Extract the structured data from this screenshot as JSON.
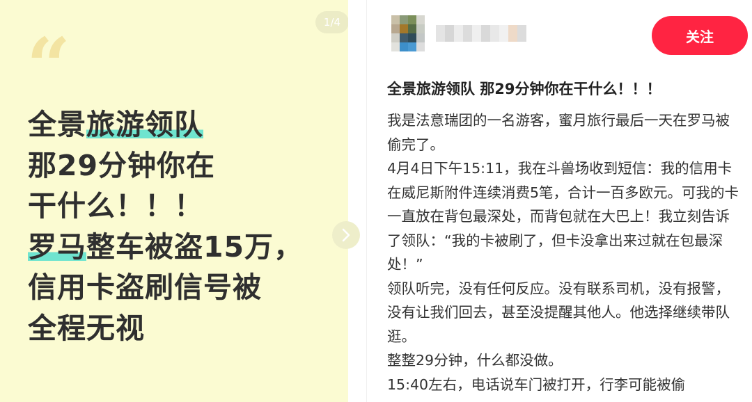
{
  "image_panel": {
    "counter": "1/4",
    "quote_glyph": "“",
    "headline_lines": [
      {
        "before": "全景",
        "highlight": "旅游领队",
        "after": ""
      },
      {
        "before": "那29分钟你在",
        "highlight": "",
        "after": ""
      },
      {
        "before": "干什么！！！",
        "highlight": "",
        "after": ""
      },
      {
        "before": "",
        "highlight": "罗马",
        "after": "整车被盗15万，"
      },
      {
        "before": "信用卡盗刷信号被",
        "highlight": "",
        "after": ""
      },
      {
        "before": "全程无视",
        "highlight": "",
        "after": ""
      }
    ],
    "highlight_color": "#6fe4cf",
    "next_icon": "chevron-right-icon"
  },
  "author": {
    "follow_label": "关注"
  },
  "post": {
    "title": "全景旅游领队 那29分钟你在干什么！！！",
    "paragraphs": [
      "我是法意瑞团的一名游客，蜜月旅行最后一天在罗马被偷完了。",
      "4月4日下午15:11，我在斗兽场收到短信：我的信用卡在威尼斯附件连续消费5笔，合计一百多欧元。可我的卡一直放在背包最深处，而背包就在大巴上！我立刻告诉了领队：“我的卡被刷了，但卡没拿出来过就在包最深处！”",
      "领队听完，没有任何反应。没有联系司机，没有报警，没有让我们回去，甚至没提醒其他人。他选择继续带队逛。",
      "整整29分钟，什么都没做。",
      "15:40左右，电话说车门被打开，行李可能被偷"
    ]
  },
  "colors": {
    "panel_background": "#fbfbd2",
    "follow_button": "#ff2442",
    "headline_text": "#2f2f2f"
  }
}
